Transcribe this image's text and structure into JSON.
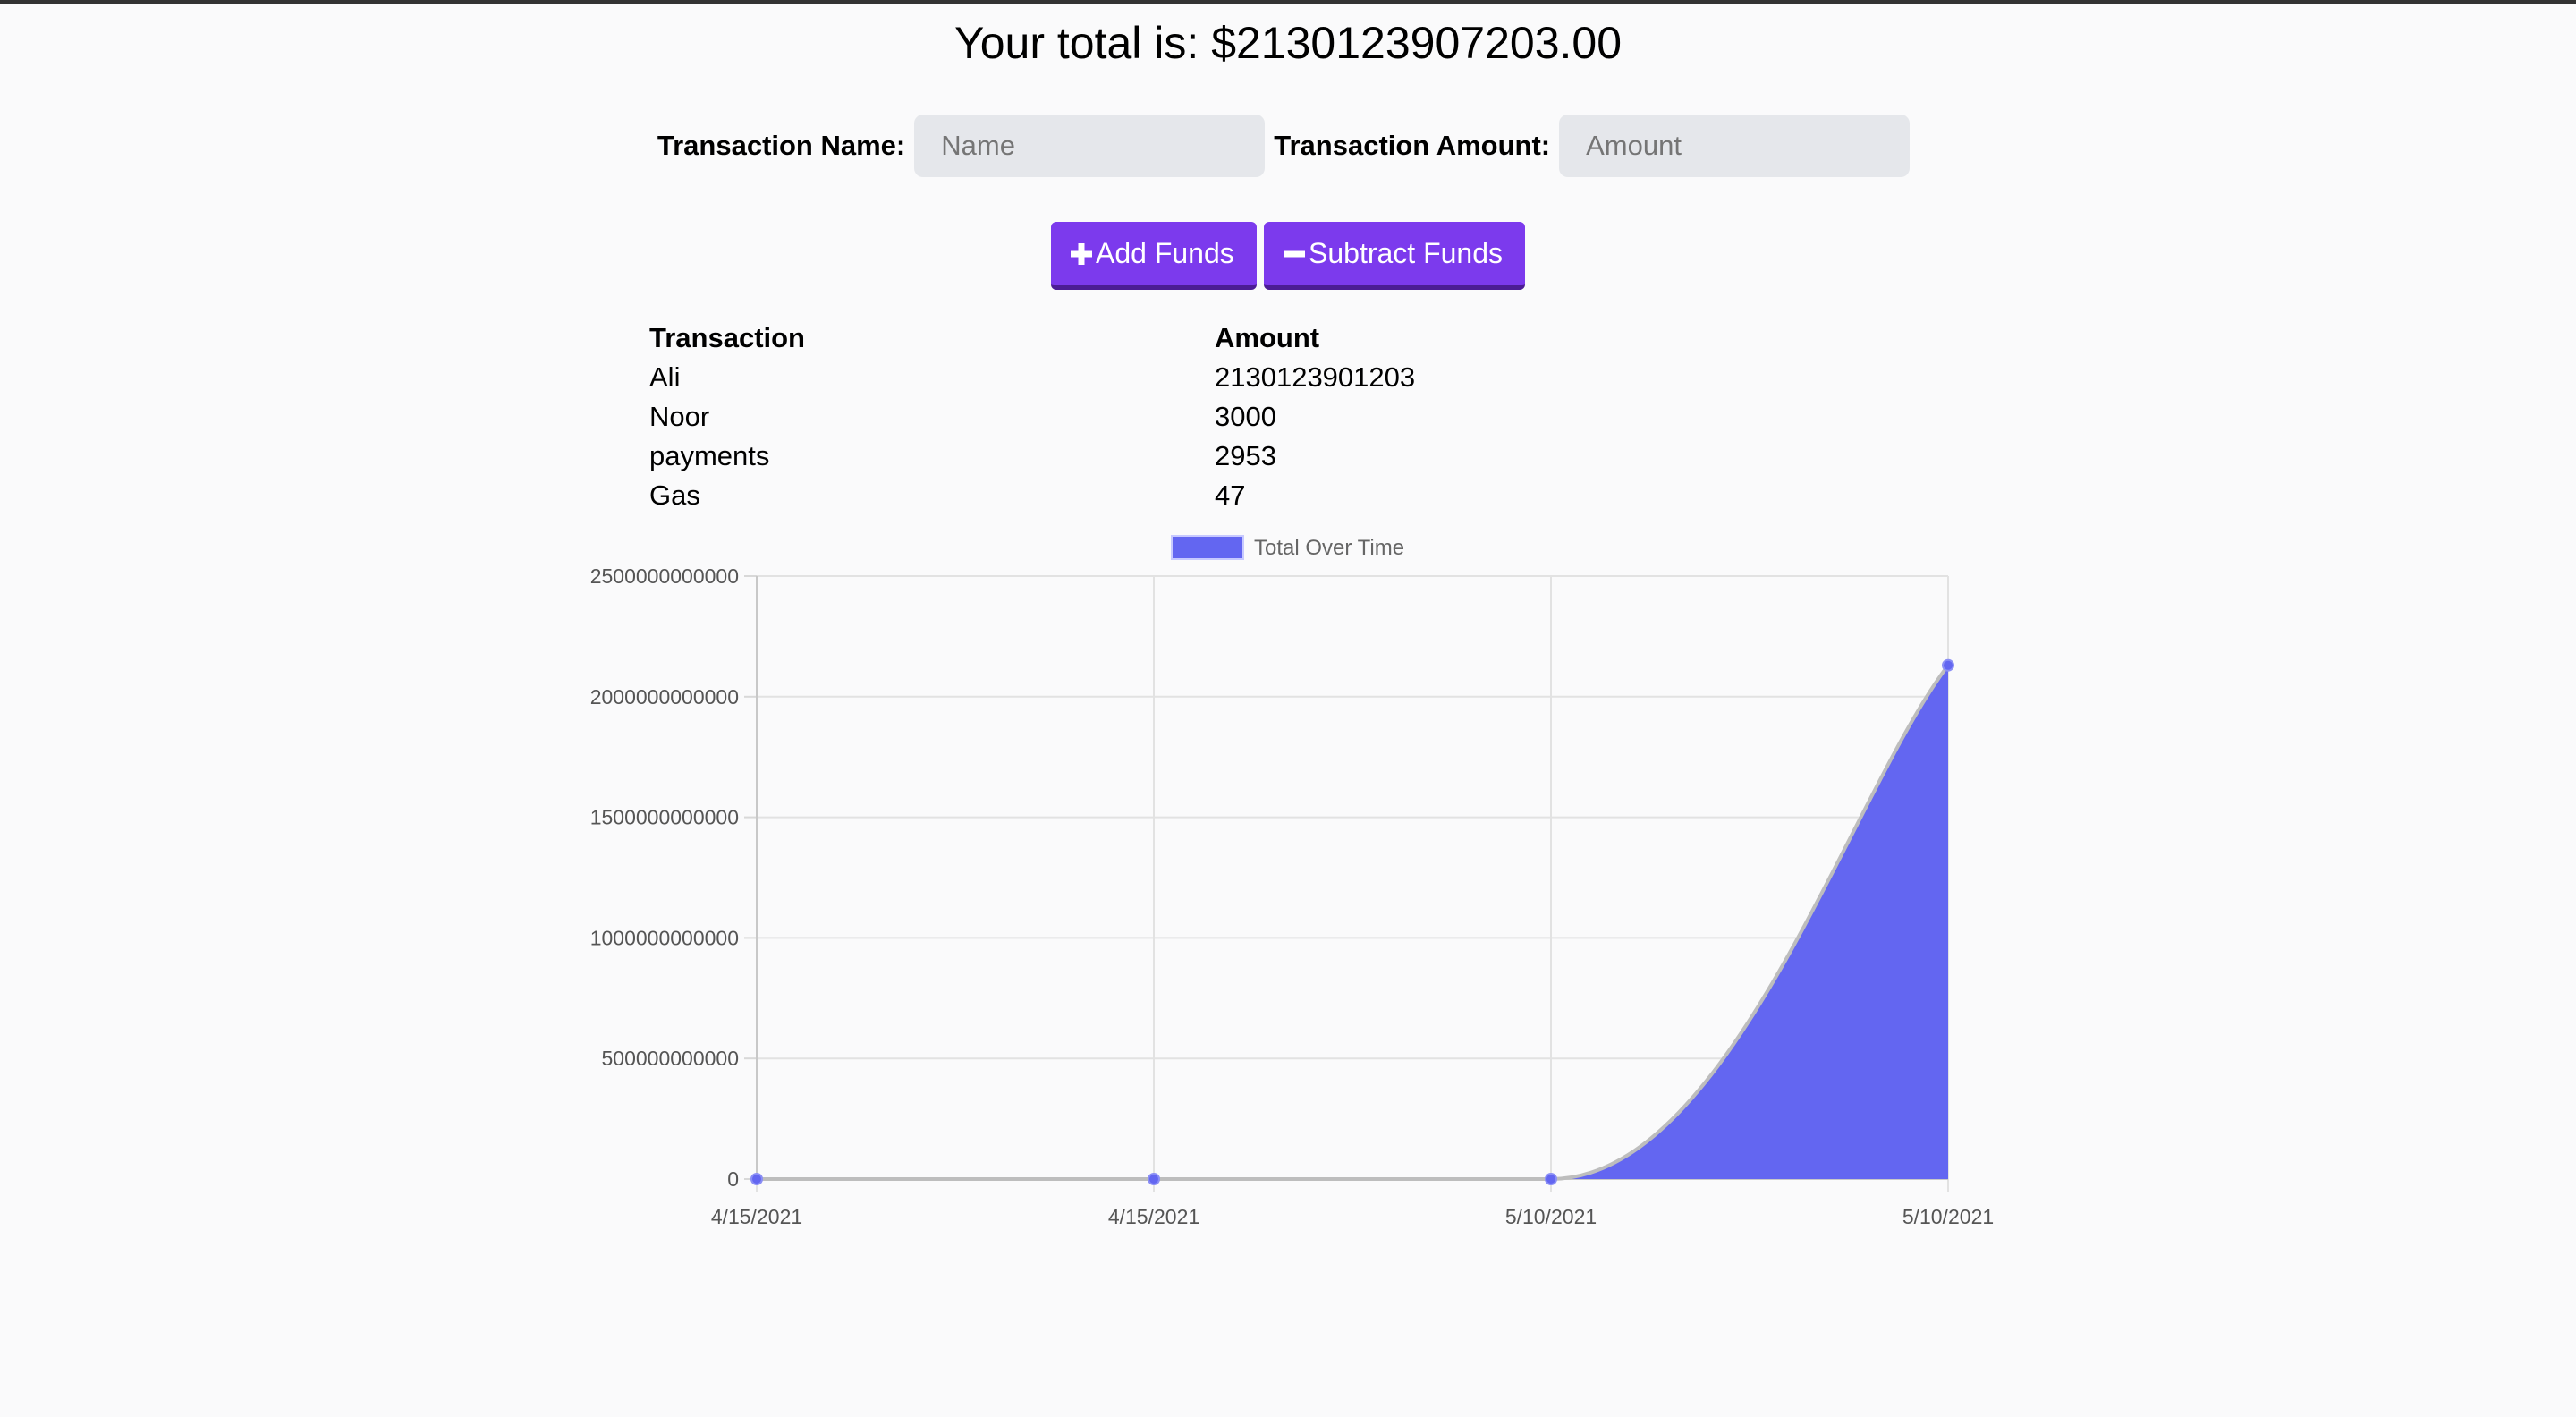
{
  "header": {
    "total_text": "Your total is: $2130123907203.00"
  },
  "form": {
    "name_label": "Transaction Name:",
    "name_placeholder": "Name",
    "name_value": "",
    "amount_label": "Transaction Amount:",
    "amount_placeholder": "Amount",
    "amount_value": ""
  },
  "buttons": {
    "add_icon": "plus-icon",
    "add_label": "Add Funds",
    "subtract_icon": "minus-icon",
    "subtract_label": "Subtract Funds",
    "accent": "#7c3aed"
  },
  "table": {
    "headers": [
      "Transaction",
      "Amount"
    ],
    "rows": [
      [
        "Ali",
        "2130123901203"
      ],
      [
        "Noor",
        "3000"
      ],
      [
        "payments",
        "2953"
      ],
      [
        "Gas",
        "47"
      ]
    ]
  },
  "chart_data": {
    "type": "area",
    "title": "",
    "xlabel": "",
    "ylabel": "",
    "x": [
      "4/15/2021",
      "4/15/2021",
      "5/10/2021",
      "5/10/2021"
    ],
    "series": [
      {
        "name": "Total Over Time",
        "values": [
          0,
          3000,
          6000,
          2130123907203
        ],
        "color": "#6366f1"
      }
    ],
    "ylim": [
      0,
      2500000000000
    ],
    "yticks": [
      0,
      500000000000,
      1000000000000,
      1500000000000,
      2000000000000,
      2500000000000
    ],
    "grid": true,
    "legend": "top-center"
  }
}
